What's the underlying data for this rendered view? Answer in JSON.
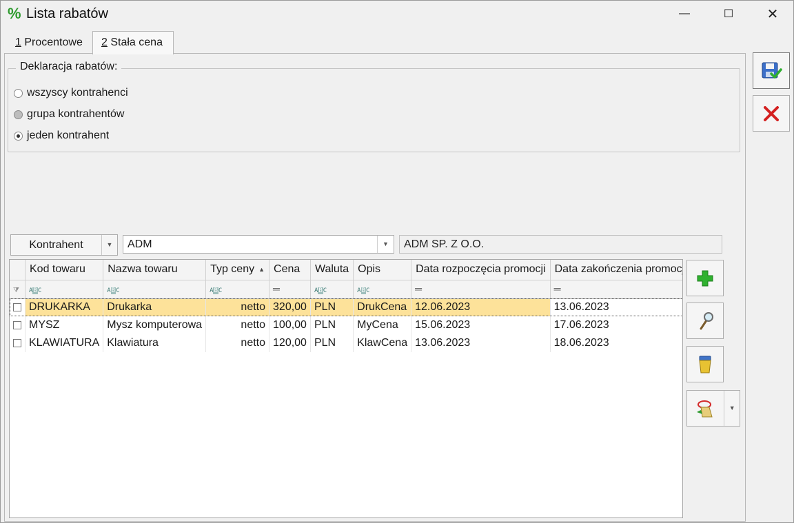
{
  "window": {
    "title": "Lista rabatów",
    "icon": "percent-icon",
    "controls": {
      "minimize": "—",
      "maximize": "☐",
      "close": "✕"
    }
  },
  "tabs": [
    {
      "hotkey": "1",
      "label": " Procentowe",
      "selected": false
    },
    {
      "hotkey": "2",
      "label": " Stała cena",
      "selected": true
    }
  ],
  "declaration": {
    "legend": "Deklaracja rabatów:",
    "options": [
      {
        "label": "wszyscy kontrahenci",
        "checked": false,
        "enabled": true
      },
      {
        "label": "grupa kontrahentów",
        "checked": false,
        "enabled": false
      },
      {
        "label": "jeden kontrahent",
        "checked": true,
        "enabled": true
      }
    ]
  },
  "contractor": {
    "button_label": "Kontrahent",
    "code_value": "ADM",
    "name_value": "ADM SP. Z O.O."
  },
  "grid": {
    "columns": [
      "",
      "Kod towaru",
      "Nazwa towaru",
      "Typ ceny",
      "Cena",
      "Waluta",
      "Opis",
      "Data rozpoczęcia promocji",
      "Data zakończenia promocji"
    ],
    "sorted_column": "Typ ceny",
    "filter_icons": [
      "funnel-icon",
      "text-filter-icon",
      "text-filter-icon",
      "text-filter-icon",
      "equals-filter-icon",
      "text-filter-icon",
      "text-filter-icon",
      "equals-filter-icon",
      "equals-filter-icon"
    ],
    "rows": [
      {
        "code": "DRUKARKA",
        "name": "Drukarka",
        "price_type": "netto",
        "price": "320,00",
        "currency": "PLN",
        "desc": "DrukCena",
        "start": "12.06.2023",
        "end": "13.06.2023",
        "selected": true
      },
      {
        "code": "MYSZ",
        "name": "Mysz komputerowa",
        "price_type": "netto",
        "price": "100,00",
        "currency": "PLN",
        "desc": "MyCena",
        "start": "15.06.2023",
        "end": "17.06.2023",
        "selected": false
      },
      {
        "code": "KLAWIATURA",
        "name": "Klawiatura",
        "price_type": "netto",
        "price": "120,00",
        "currency": "PLN",
        "desc": "KlawCena",
        "start": "13.06.2023",
        "end": "18.06.2023",
        "selected": false
      }
    ]
  },
  "side_buttons": [
    "add-icon",
    "edit-magnifier-icon",
    "delete-bin-icon",
    "change-settings-icon"
  ],
  "action_buttons": [
    "save-icon",
    "cancel-icon"
  ],
  "colors": {
    "selected_row": "#fde29a",
    "accent_green": "#2e9a2e",
    "cancel_red": "#d42020"
  }
}
